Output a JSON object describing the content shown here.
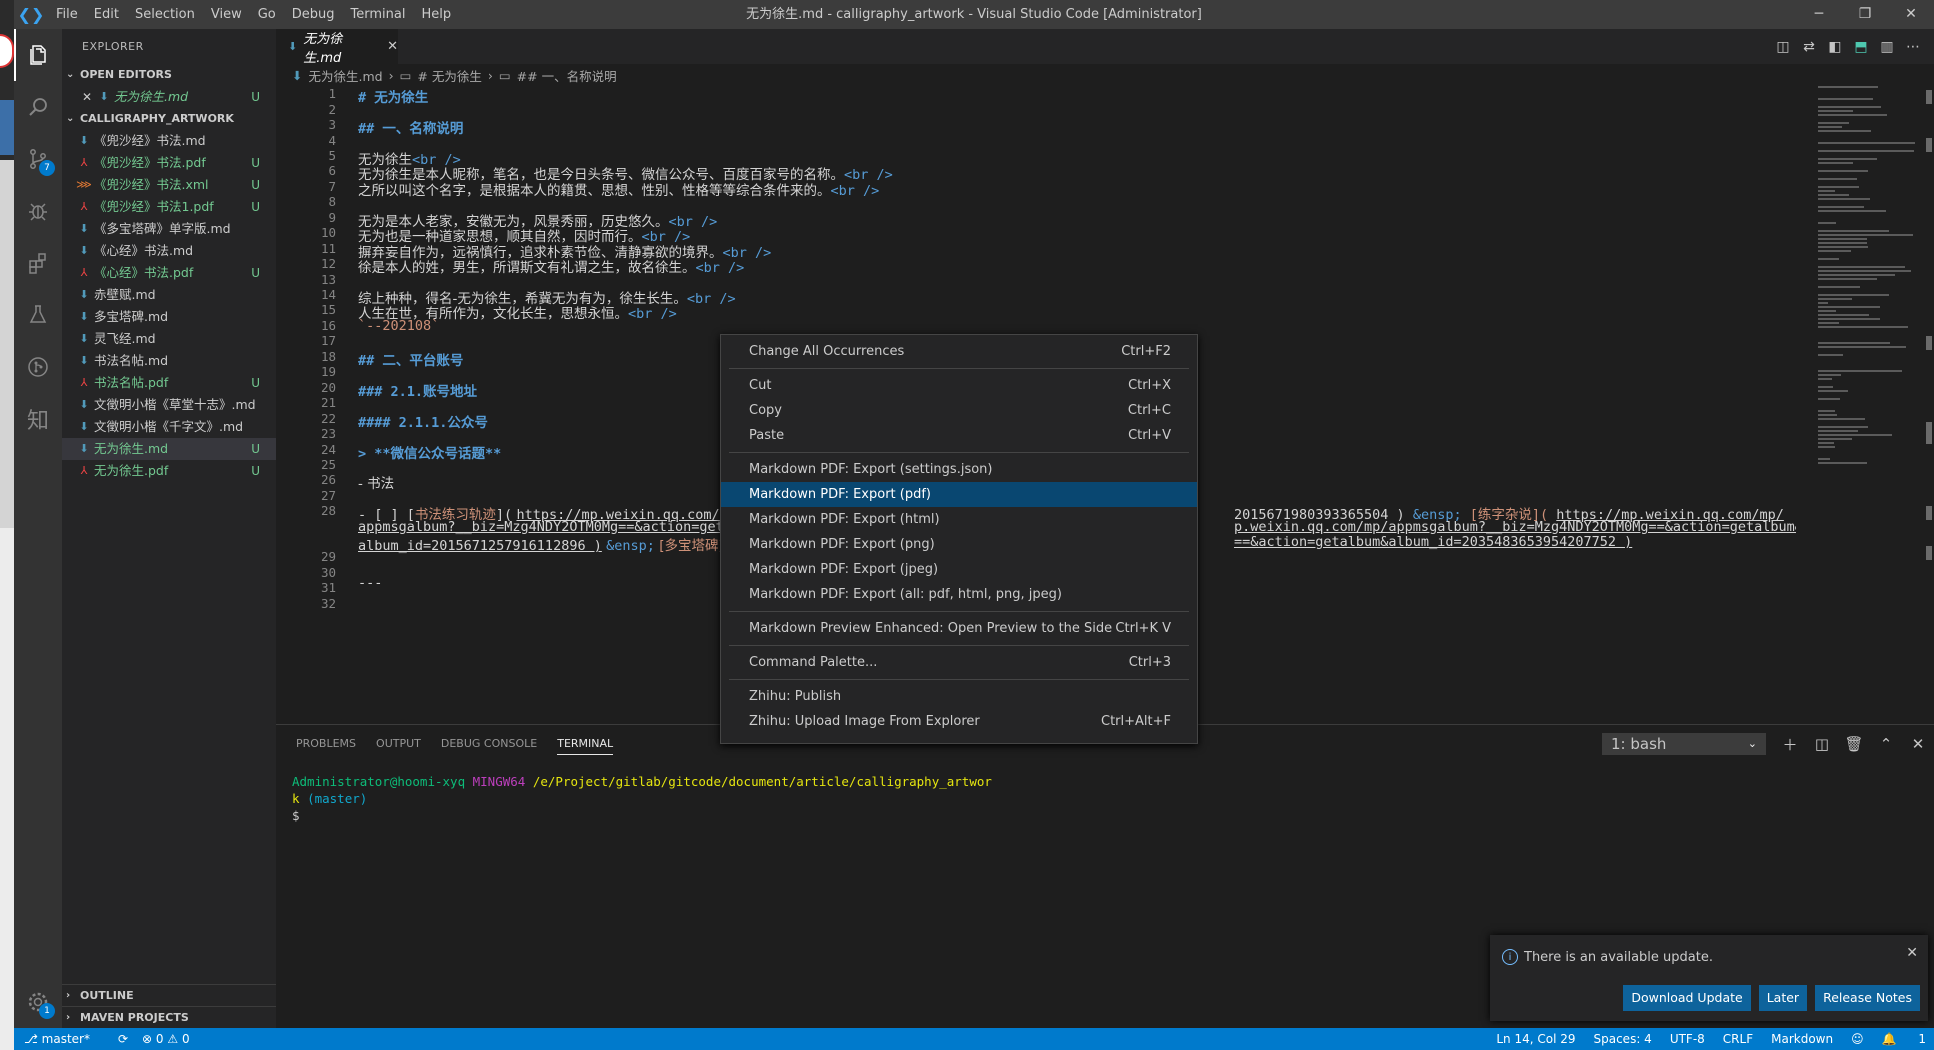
{
  "window": {
    "title": "无为徐生.md - calligraphy_artwork - Visual Studio Code [Administrator]",
    "menu": [
      "File",
      "Edit",
      "Selection",
      "View",
      "Go",
      "Debug",
      "Terminal",
      "Help"
    ],
    "controls": [
      "─",
      "❐",
      "✕"
    ]
  },
  "activity": {
    "scm_badge": "7",
    "settings_badge": "1",
    "zhihu_glyph": "知"
  },
  "sidebar": {
    "title": "EXPLORER",
    "open_editors_label": "OPEN EDITORS",
    "open_editor": {
      "name": "无为徐生.md",
      "status": "U"
    },
    "folder_label": "CALLIGRAPHY_ARTWORK",
    "files": [
      {
        "name": "《兜沙经》书法.md",
        "type": "md",
        "status": ""
      },
      {
        "name": "《兜沙经》书法.pdf",
        "type": "pdf",
        "status": "U"
      },
      {
        "name": "《兜沙经》书法.xml",
        "type": "xml",
        "status": "U"
      },
      {
        "name": "《兜沙经》书法1.pdf",
        "type": "pdf",
        "status": "U"
      },
      {
        "name": "《多宝塔碑》单字版.md",
        "type": "md",
        "status": ""
      },
      {
        "name": "《心经》书法.md",
        "type": "md",
        "status": ""
      },
      {
        "name": "《心经》书法.pdf",
        "type": "pdf",
        "status": "U"
      },
      {
        "name": "赤壁赋.md",
        "type": "md",
        "status": ""
      },
      {
        "name": "多宝塔碑.md",
        "type": "md",
        "status": ""
      },
      {
        "name": "灵飞经.md",
        "type": "md",
        "status": ""
      },
      {
        "name": "书法名帖.md",
        "type": "md",
        "status": ""
      },
      {
        "name": "书法名帖.pdf",
        "type": "pdf",
        "status": "U"
      },
      {
        "name": "文徵明小楷《草堂十志》.md",
        "type": "md",
        "status": ""
      },
      {
        "name": "文徵明小楷《千字文》.md",
        "type": "md",
        "status": ""
      },
      {
        "name": "无为徐生.md",
        "type": "md",
        "status": "U"
      },
      {
        "name": "无为徐生.pdf",
        "type": "pdf",
        "status": "U"
      }
    ],
    "outline_label": "OUTLINE",
    "maven_label": "MAVEN PROJECTS"
  },
  "editor": {
    "tab_label": "无为徐生.md",
    "breadcrumb": [
      "无为徐生.md",
      "# 无为徐生",
      "## 一、名称说明"
    ],
    "lines": {
      "l1": "# 无为徐生",
      "l3": "## 一、名称说明",
      "l5": "无为徐生",
      "l6": "无为徐生是本人昵称，笔名，也是今日头条号、微信公众号、百度百家号的名称。",
      "l7": "之所以叫这个名字，是根据本人的籍贯、思想、性别、性格等等综合条件来的。",
      "l9": "无为是本人老家，安徽无为，风景秀丽，历史悠久。",
      "l10": "无为也是一种道家思想，顺其自然，因时而行。",
      "l11": "摒弃妄自作为，远祸慎行，追求朴素节俭、清静寡欲的境界。",
      "l12": "徐是本人的姓，男生，所谓斯文有礼谓之生，故名徐生。",
      "l14": "综上种种，得名-无为徐生，希冀无为有为，徐生长生。",
      "l15": "人生在世，有所作为，文化长生，思想永恒。",
      "l16": "`--202108`",
      "l18": "## 二、平台账号",
      "l20": "### 2.1.账号地址",
      "l22": "#### 2.1.1.公众号",
      "l24": "> **微信公众号话题**",
      "l26": "- 书法",
      "l28a_pre": "- [ ] [",
      "l28a_link": "书法练习轨迹",
      "l28a_mid": "](",
      "l28a_url": "https://mp.weixin.qq.com/mp",
      "l28a_tail_id": "2015671980393365504 )",
      "l28a_ensp": "&ensp;",
      "l28a_link2": "[练字杂说](",
      "l28a_url2": "https://mp.weixin.qq.com/mp/",
      "l28b_head": "appmsgalbum?__biz=Mzg4NDY2OTM0Mg==&action=getal",
      "l28b_tail": "p.weixin.qq.com/mp/appmsgalbum?__biz=Mzg4NDY2OTM0Mg==&action=getalbum&",
      "l28c_head": "album_id=2015671257916112896 )",
      "l28c_ensp": "&ensp;",
      "l28c_link": "[多宝塔碑]",
      "l28c_tail": "==&action=getalbum&album_id=2035483653954207752 )",
      "l31": "---",
      "br": "<br />"
    },
    "line_numbers": [
      "1",
      "2",
      "3",
      "4",
      "5",
      "6",
      "7",
      "8",
      "9",
      "10",
      "11",
      "12",
      "13",
      "14",
      "15",
      "16",
      "17",
      "18",
      "19",
      "20",
      "21",
      "22",
      "23",
      "24",
      "25",
      "26",
      "27",
      "28",
      "29",
      "30",
      "31",
      "32"
    ]
  },
  "context_menu": {
    "items": [
      {
        "label": "Change All Occurrences",
        "key": "Ctrl+F2"
      },
      {
        "label": "Cut",
        "key": "Ctrl+X"
      },
      {
        "label": "Copy",
        "key": "Ctrl+C"
      },
      {
        "label": "Paste",
        "key": "Ctrl+V"
      },
      {
        "label": "Markdown PDF: Export (settings.json)",
        "key": ""
      },
      {
        "label": "Markdown PDF: Export (pdf)",
        "key": ""
      },
      {
        "label": "Markdown PDF: Export (html)",
        "key": ""
      },
      {
        "label": "Markdown PDF: Export (png)",
        "key": ""
      },
      {
        "label": "Markdown PDF: Export (jpeg)",
        "key": ""
      },
      {
        "label": "Markdown PDF: Export (all: pdf, html, png, jpeg)",
        "key": ""
      },
      {
        "label": "Markdown Preview Enhanced: Open Preview to the Side",
        "key": "Ctrl+K V"
      },
      {
        "label": "Command Palette...",
        "key": "Ctrl+3"
      },
      {
        "label": "Zhihu: Publish",
        "key": ""
      },
      {
        "label": "Zhihu: Upload Image From Explorer",
        "key": "Ctrl+Alt+F"
      }
    ]
  },
  "panel": {
    "tabs": [
      "PROBLEMS",
      "OUTPUT",
      "DEBUG CONSOLE",
      "TERMINAL"
    ],
    "terminal_select": "1: bash",
    "terminal": {
      "user": "Administrator@hoomi-xyq",
      "host": "MINGW64",
      "path": "/e/Project/gitlab/gitcode/document/article/calligraphy_artwor",
      "path2": "k",
      "branch": "(master)",
      "prompt": "$"
    }
  },
  "notification": {
    "message": "There is an available update.",
    "buttons": [
      "Download Update",
      "Later",
      "Release Notes"
    ]
  },
  "status": {
    "branch": "master*",
    "errors": "⊗ 0 ⚠ 0",
    "position": "Ln 14, Col 29",
    "spaces": "Spaces: 4",
    "encoding": "UTF-8",
    "eol": "CRLF",
    "language": "Markdown",
    "bell": "1"
  }
}
